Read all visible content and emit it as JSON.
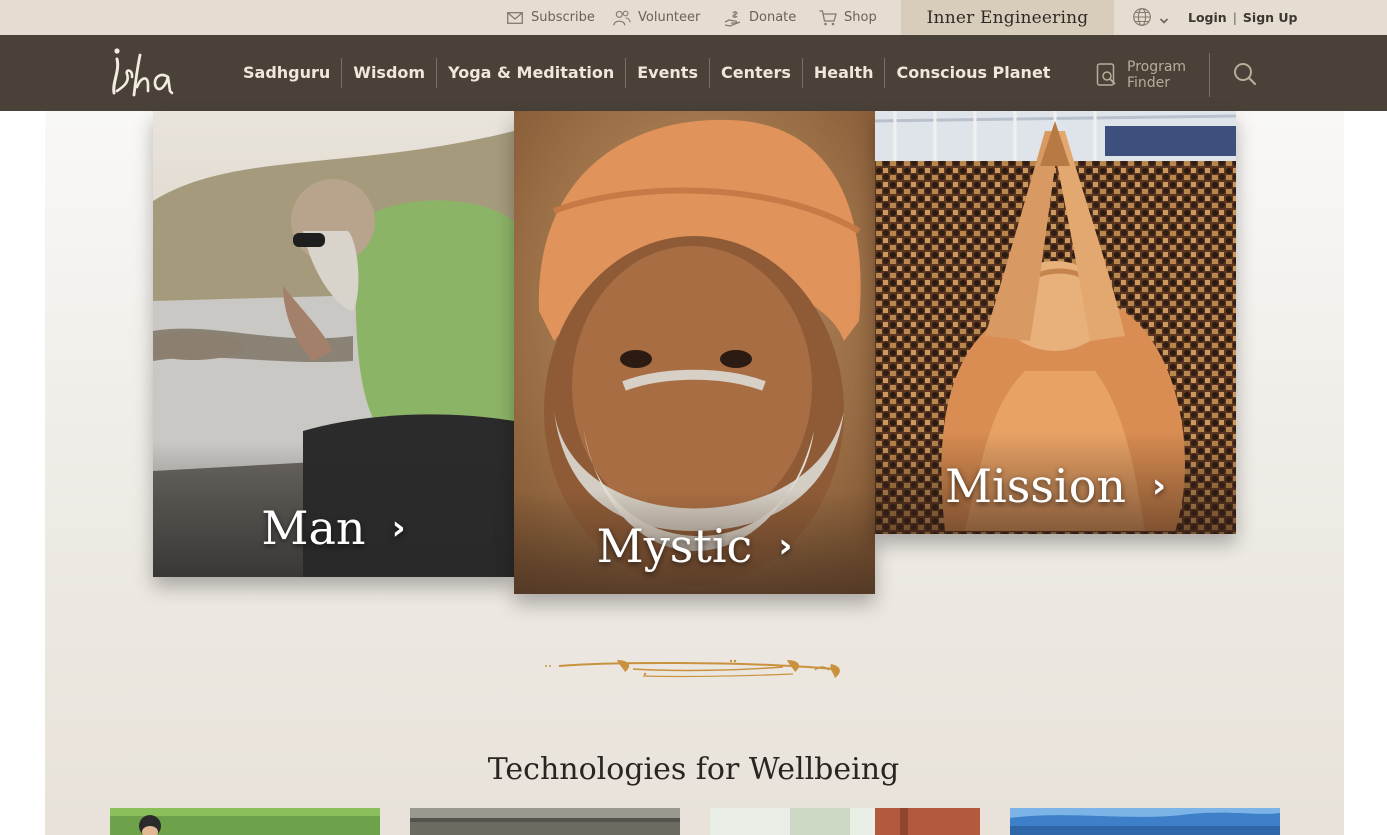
{
  "topbar": {
    "subscribe": "Subscribe",
    "volunteer": "Volunteer",
    "donate": "Donate",
    "shop": "Shop",
    "inner_engineering": "Inner Engineering",
    "login": "Login",
    "signup": "Sign Up"
  },
  "nav": {
    "logo_text": "isha",
    "items": [
      "Sadhguru",
      "Wisdom",
      "Yoga & Meditation",
      "Events",
      "Centers",
      "Health",
      "Conscious Planet"
    ],
    "program_finder_line1": "Program",
    "program_finder_line2": "Finder"
  },
  "hero": {
    "cards": [
      {
        "label": "Man"
      },
      {
        "label": "Mystic"
      },
      {
        "label": "Mission"
      }
    ],
    "chevron": "›"
  },
  "section": {
    "title": "Technologies for Wellbeing"
  },
  "colors": {
    "topbar_bg": "#e5ddd1",
    "nav_bg": "#4a4139",
    "accent_gold": "#c9923e",
    "inner_engineering_bg": "#d8cdbb"
  },
  "icons": [
    "mail-icon",
    "people-icon",
    "donate-hand-icon",
    "cart-icon",
    "globe-icon",
    "chevron-down-icon",
    "program-finder-icon",
    "search-icon"
  ]
}
